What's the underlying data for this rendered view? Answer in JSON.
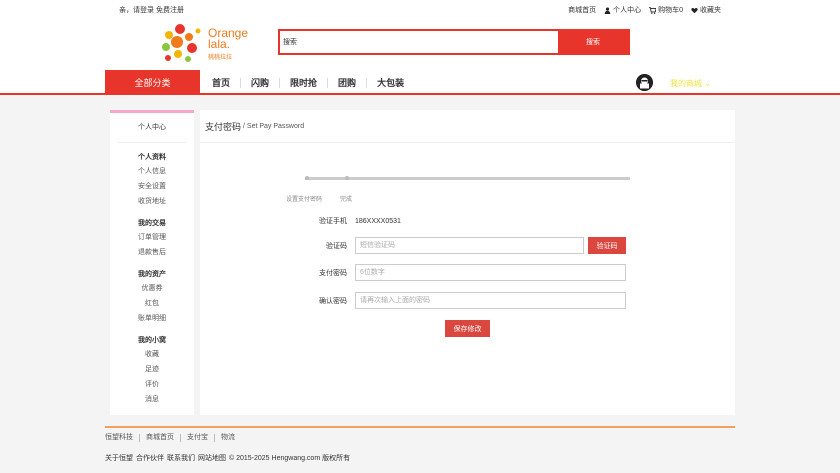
{
  "topbar": {
    "login_text": "亲，请登录 免费注册",
    "links": [
      "商城首页",
      "个人中心",
      "购物车0",
      "收藏夹"
    ]
  },
  "logo": {
    "brand_line1": "Orange",
    "brand_line2": "lala.",
    "brand_cn": "桃桃拉拉"
  },
  "search": {
    "placeholder": "搜索",
    "button_label": "搜索"
  },
  "nav": {
    "categories_label": "全部分类",
    "items": [
      "首页",
      "闪购",
      "限时抢",
      "团购",
      "大包装"
    ],
    "my_center_label": "我的商城"
  },
  "sidebar": {
    "home": "个人中心",
    "groups": [
      {
        "title": "个人资料",
        "items": [
          "个人信息",
          "安全设置",
          "收货地址"
        ]
      },
      {
        "title": "我的交易",
        "items": [
          "订单管理",
          "退款售后"
        ]
      },
      {
        "title": "我的资产",
        "items": [
          "优惠券",
          "红包",
          "账单明细"
        ]
      },
      {
        "title": "我的小窝",
        "items": [
          "收藏",
          "足迹",
          "评价",
          "消息"
        ]
      }
    ]
  },
  "content": {
    "title_cn": "支付密码",
    "title_en": "/ Set Pay Password",
    "steps": [
      "设置支付密码",
      "完成"
    ],
    "phone_label": "验证手机",
    "phone_value": "186XXXX0531",
    "code_label": "验证码",
    "code_placeholder": "短信验证码",
    "code_button": "验证码",
    "pwd_label": "支付密码",
    "pwd_placeholder": "6位数字",
    "confirm_label": "确认密码",
    "confirm_placeholder": "请再次输入上面的密码",
    "save_button": "保存修改"
  },
  "footer": {
    "links": [
      "恒望科技",
      "商城首页",
      "支付宝",
      "物流"
    ],
    "bottom_links": [
      "关于恒望",
      "合作伙伴",
      "联系我们",
      "网站地图"
    ],
    "copyright": "© 2015-2025 Hengwang.com 版权所有"
  },
  "colors": {
    "accent": "#e8352b",
    "brand": "#f07a1c",
    "footer_line": "#f0a060"
  }
}
